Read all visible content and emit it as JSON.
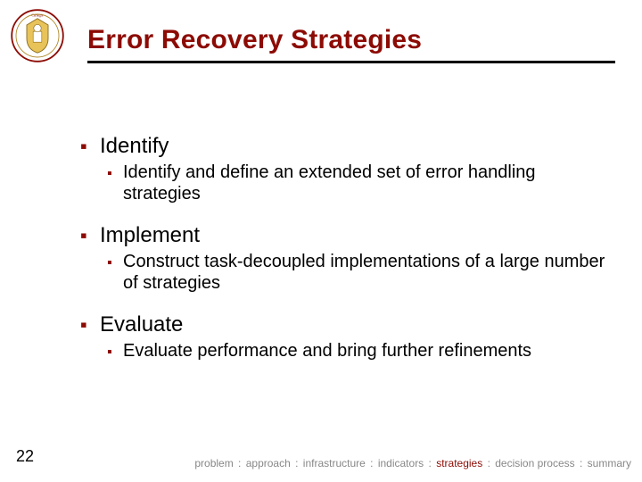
{
  "title": "Error Recovery Strategies",
  "page_number": "22",
  "items": [
    {
      "label": "Identify",
      "sub": "Identify and define an extended set of error handling strategies"
    },
    {
      "label": "Implement",
      "sub": "Construct task-decoupled implementations of a large number of strategies"
    },
    {
      "label": "Evaluate",
      "sub": "Evaluate performance and bring further refinements"
    }
  ],
  "breadcrumbs": {
    "active_index": 4,
    "items": [
      "problem",
      "approach",
      "infrastructure",
      "indicators",
      "strategies",
      "decision process",
      "summary"
    ]
  }
}
